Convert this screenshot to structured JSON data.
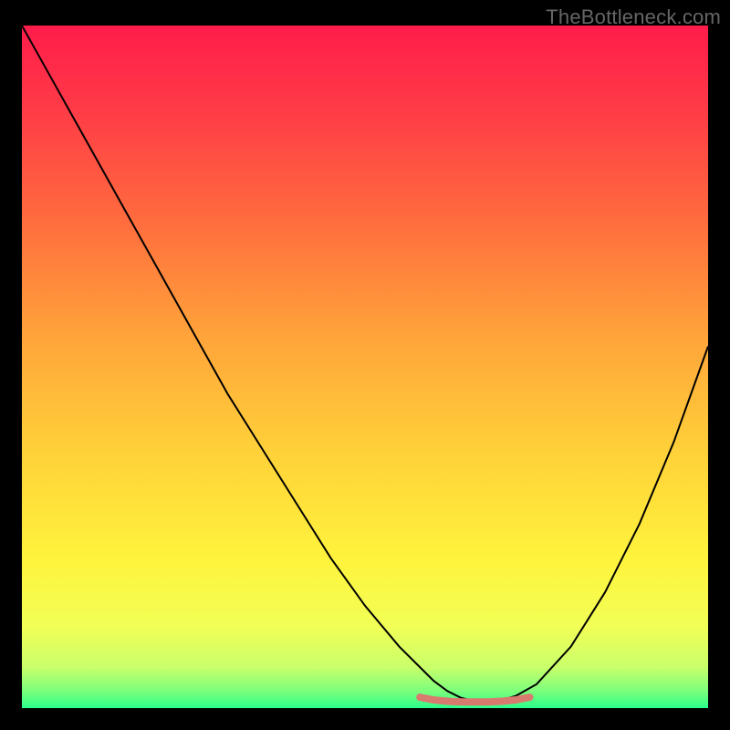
{
  "watermark": "TheBottleneck.com",
  "chart_data": {
    "type": "line",
    "title": "",
    "xlabel": "",
    "ylabel": "",
    "xlim": [
      0,
      100
    ],
    "ylim": [
      0,
      100
    ],
    "grid": false,
    "legend": false,
    "background_gradient": {
      "stops": [
        {
          "offset": 0.0,
          "color": "#ff1c4b"
        },
        {
          "offset": 0.12,
          "color": "#ff3a47"
        },
        {
          "offset": 0.28,
          "color": "#ff6a3e"
        },
        {
          "offset": 0.45,
          "color": "#ffa23a"
        },
        {
          "offset": 0.62,
          "color": "#ffd039"
        },
        {
          "offset": 0.78,
          "color": "#fff33c"
        },
        {
          "offset": 0.88,
          "color": "#f2ff56"
        },
        {
          "offset": 0.94,
          "color": "#c9ff6a"
        },
        {
          "offset": 0.975,
          "color": "#7cff7c"
        },
        {
          "offset": 1.0,
          "color": "#2aff8a"
        }
      ]
    },
    "series": [
      {
        "name": "curve",
        "color": "#000000",
        "width": 2,
        "x": [
          0,
          5,
          10,
          15,
          20,
          25,
          30,
          35,
          40,
          45,
          50,
          55,
          58,
          60,
          62,
          64,
          66,
          68,
          70,
          72,
          75,
          80,
          85,
          90,
          95,
          100
        ],
        "y": [
          100,
          91,
          82,
          73,
          64,
          55,
          46,
          38,
          30,
          22,
          15,
          9,
          6,
          4,
          2.5,
          1.5,
          1,
          1,
          1.2,
          1.8,
          3.5,
          9,
          17,
          27,
          39,
          53
        ]
      },
      {
        "name": "trough-marker",
        "color": "#d97a6f",
        "width": 8,
        "x": [
          58,
          60,
          62,
          64,
          66,
          68,
          70,
          72,
          74
        ],
        "y": [
          1.6,
          1.2,
          1.0,
          0.9,
          0.9,
          0.9,
          1.0,
          1.2,
          1.6
        ]
      }
    ]
  }
}
